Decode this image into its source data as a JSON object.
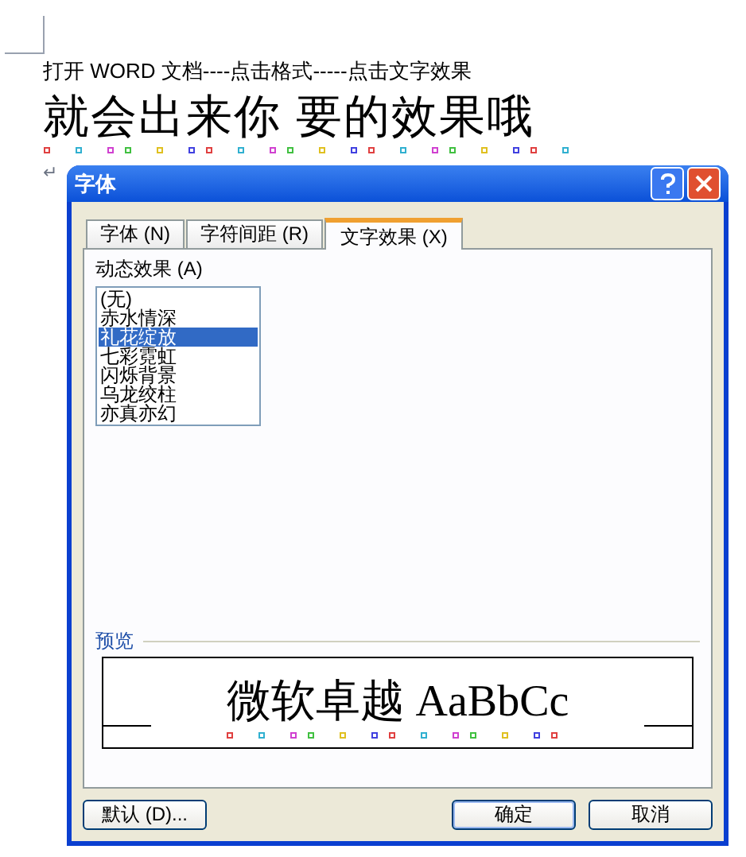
{
  "document": {
    "lines": [
      {
        "kind": "plain",
        "text": "打开 WORD 文档----点击格式-----点击文字效果"
      },
      {
        "kind": "sparkle",
        "text": "就会出来你 要的效果哦"
      }
    ],
    "paragraph_mark": "↵"
  },
  "dialog": {
    "title": "字体",
    "tabs": [
      {
        "label": "字体 (N)",
        "selected": false
      },
      {
        "label": "字符间距 (R)",
        "selected": false
      },
      {
        "label": "文字效果 (X)",
        "selected": true
      }
    ],
    "animation_label": "动态效果 (A)",
    "effects": [
      {
        "label": "(无)",
        "selected": false
      },
      {
        "label": "赤水情深",
        "selected": false
      },
      {
        "label": "礼花绽放",
        "selected": true
      },
      {
        "label": "七彩霓虹",
        "selected": false
      },
      {
        "label": "闪烁背景",
        "selected": false
      },
      {
        "label": "乌龙绞柱",
        "selected": false
      },
      {
        "label": "亦真亦幻",
        "selected": false
      }
    ],
    "preview_label": "预览",
    "preview_text": "微软卓越 AaBbCc",
    "buttons": [
      {
        "label": "默认 (D)...",
        "kind": "left"
      },
      {
        "label": "确定",
        "kind": "primary"
      },
      {
        "label": "取消",
        "kind": "normal"
      }
    ]
  }
}
